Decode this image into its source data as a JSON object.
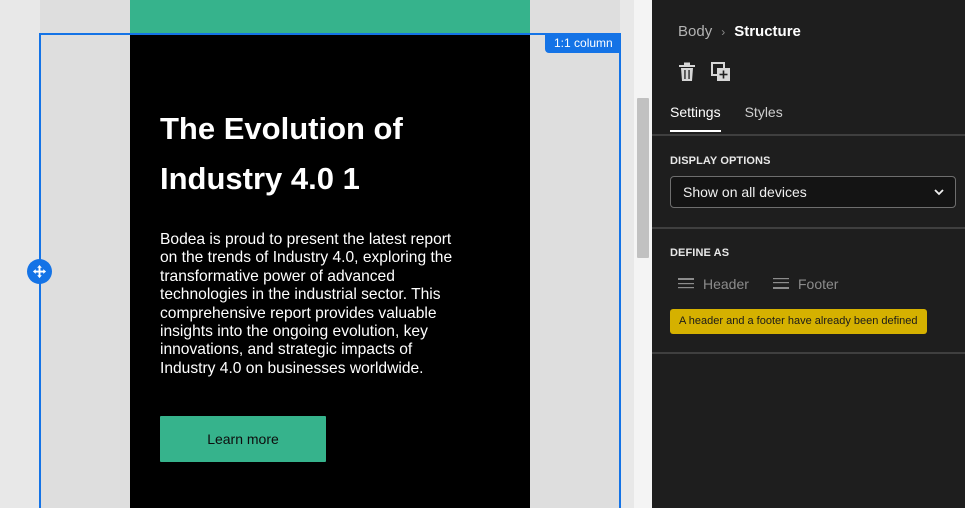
{
  "canvas": {
    "headline": "The Evolution of Industry 4.0 1",
    "body": "Bodea is proud to present the latest report on the trends of Industry 4.0, exploring the transformative power of advanced technologies in the industrial sector. This comprehensive report provides valuable insights into the ongoing evolution, key innovations, and strategic impacts of Industry 4.0 on businesses worldwide.",
    "button_label": "Learn more",
    "column_badge": "1:1 column"
  },
  "panel": {
    "breadcrumb": {
      "parent": "Body",
      "separator": "›",
      "current": "Structure"
    },
    "toolbar": {
      "delete_icon": "trash-icon",
      "duplicate_icon": "duplicate-icon"
    },
    "tabs": [
      {
        "label": "Settings",
        "active": true
      },
      {
        "label": "Styles",
        "active": false
      }
    ],
    "display_options": {
      "label": "DISPLAY OPTIONS",
      "selected": "Show on all devices"
    },
    "define_as": {
      "label": "DEFINE AS",
      "header_label": "Header",
      "footer_label": "Footer",
      "warning": "A header and a footer have already been defined"
    }
  },
  "colors": {
    "accent_blue": "#1473e6",
    "brand_green": "#36b38c",
    "warning_yellow": "#d5b100",
    "panel_bg": "#1e1e1e"
  }
}
